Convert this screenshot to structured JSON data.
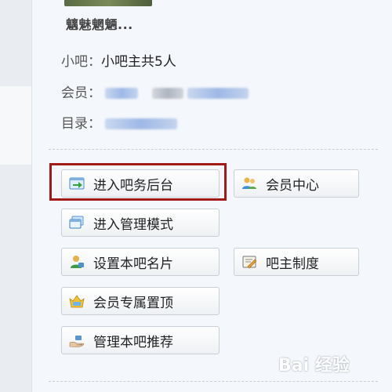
{
  "bar": {
    "name": "魑魅魍魉..."
  },
  "info": {
    "xiaoba_label": "小吧：",
    "xiaoba_value": "小吧主共5人",
    "member_label": "会员：",
    "catalog_label": "目录："
  },
  "actions": {
    "enter_backend": "进入吧务后台",
    "member_center": "会员中心",
    "manage_mode": "进入管理模式",
    "set_card": "设置本吧名片",
    "owner_rules": "吧主制度",
    "member_top": "会员专属置顶",
    "manage_recommend": "管理本吧推荐"
  },
  "watermark": {
    "text": "Bai 经验"
  },
  "colors": {
    "highlight_border": "#a21a1a",
    "panel_bg": "#f4f7fb"
  }
}
